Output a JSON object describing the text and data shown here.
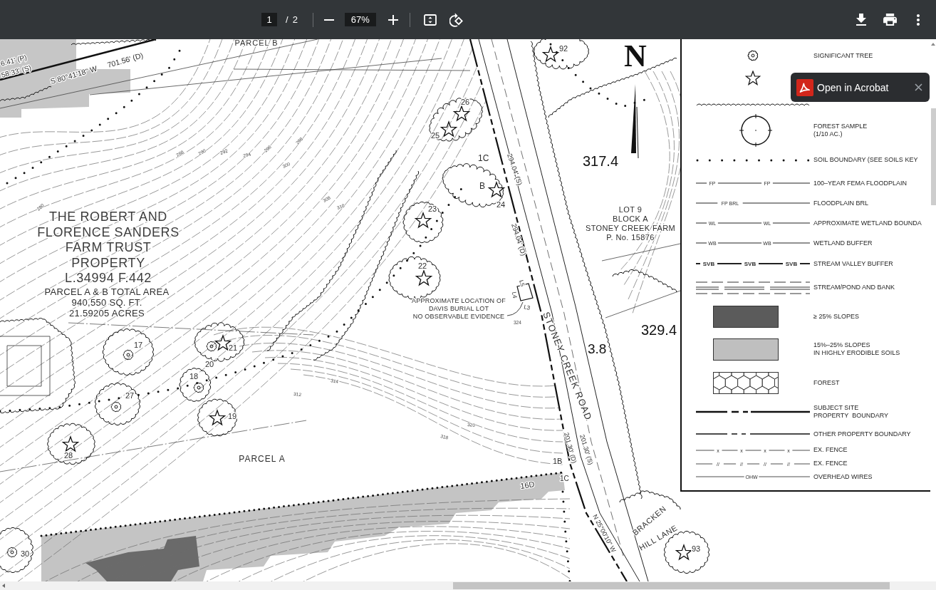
{
  "toolbar": {
    "page_number": "1",
    "page_separator": "/",
    "page_count": "2",
    "zoom_value": "67%"
  },
  "popup": {
    "label": "Open in Acrobat"
  },
  "map": {
    "parcel_labels": [
      "PARCEL B",
      "PARCEL A"
    ],
    "property_title": [
      "THE ROBERT AND",
      "FLORENCE SANDERS",
      "FARM TRUST",
      "PROPERTY",
      "L.34994 F.442"
    ],
    "property_area": [
      "PARCEL A & B TOTAL AREA",
      "940,550 SQ. FT.",
      "21.59205 ACRES"
    ],
    "bearings": [
      "6.41' (P)",
      "58.33' (S)",
      "S 80°41'18\" W",
      "701.56' (D)",
      "294.04' (S)",
      "294.04' (D)",
      "201.30' (S)",
      "201.30' (D)",
      "N 25°00'10\" W"
    ],
    "trees": [
      {
        "number": "26",
        "kind": "specimen"
      },
      {
        "number": "25",
        "kind": "specimen"
      },
      {
        "number": "24",
        "kind": "specimen"
      },
      {
        "number": "23",
        "kind": "specimen"
      },
      {
        "number": "22",
        "kind": "specimen"
      },
      {
        "number": "92",
        "kind": "specimen"
      },
      {
        "number": "17",
        "kind": "significant"
      },
      {
        "number": "21",
        "kind": "specimen"
      },
      {
        "number": "20",
        "kind": "significant"
      },
      {
        "number": "18",
        "kind": "significant"
      },
      {
        "number": "27",
        "kind": "significant"
      },
      {
        "number": "19",
        "kind": "specimen"
      },
      {
        "number": "28",
        "kind": "specimen"
      },
      {
        "number": "30",
        "kind": "significant"
      },
      {
        "number": "93",
        "kind": "specimen"
      }
    ],
    "point_labels": [
      "1C",
      "B",
      "1B",
      "1C",
      "16D"
    ],
    "line_labels": [
      "L5",
      "L4",
      "L3"
    ],
    "burial_note": [
      "APPROXIMATE LOCATION OF",
      "DAVIS BURIAL LOT",
      "NO OBSERVABLE EVIDENCE"
    ],
    "lot_label": [
      "LOT 9",
      "BLOCK A",
      "STONEY CREEK FARM",
      "P. No. 15876"
    ],
    "road_label": "STONEY CREEK ROAD",
    "lane_label": [
      "BRACKEN",
      "HILL LANE"
    ],
    "spot_elevations": [
      "317.4",
      "329.4",
      "3.8"
    ],
    "north_label": "N",
    "contour_labels": [
      "288",
      "290",
      "292",
      "294",
      "296",
      "298",
      "300",
      "308",
      "310",
      "280",
      "314",
      "312",
      "320",
      "318",
      "324"
    ]
  },
  "legend": {
    "rows": [
      {
        "kind": "significant-tree",
        "label": "SIGNIFICANT TREE"
      },
      {
        "kind": "specimen-tree"
      },
      {
        "kind": "canopy"
      },
      {
        "kind": "sample-plot",
        "label": "FOREST SAMPLE\n(1/10 AC.)"
      },
      {
        "kind": "dots",
        "label": "SOIL BOUNDARY (SEE SOILS KEY"
      },
      {
        "kind": "marked-line",
        "marks": [
          "FP",
          "FP"
        ],
        "label": "100–YEAR FEMA FLOODPLAIN"
      },
      {
        "kind": "marked-line",
        "marks": [
          "FP BRL"
        ],
        "label": "FLOODPLAIN BRL"
      },
      {
        "kind": "marked-line",
        "marks": [
          "WL",
          "WL"
        ],
        "label": "APPROXIMATE WETLAND BOUNDA"
      },
      {
        "kind": "marked-line",
        "marks": [
          "WB",
          "WB"
        ],
        "label": "WETLAND BUFFER"
      },
      {
        "kind": "bold-marked-line",
        "marks": [
          "SVB",
          "SVB",
          "SVB"
        ],
        "label": "STREAM VALLEY BUFFER"
      },
      {
        "kind": "stream",
        "label": "STREAM/POND AND BANK"
      },
      {
        "kind": "steep-swatch",
        "label": "≥ 25% SLOPES"
      },
      {
        "kind": "moderate-swatch",
        "label": "15%–25% SLOPES\nIN HIGHLY ERODIBLE SOILS"
      },
      {
        "kind": "forest-swatch",
        "label": "FOREST"
      },
      {
        "kind": "subject-boundary",
        "label": "SUBJECT SITE\nPROPERTY  BOUNDARY"
      },
      {
        "kind": "other-boundary",
        "label": "OTHER PROPERTY BOUNDARY"
      },
      {
        "kind": "fence",
        "marks": [
          "x",
          "x",
          "x",
          "x"
        ],
        "label": "EX. FENCE"
      },
      {
        "kind": "fence",
        "marks": [
          "//",
          "//",
          "//",
          "//"
        ],
        "label": "EX. FENCE"
      },
      {
        "kind": "wires",
        "marks": [
          "OHW"
        ],
        "label": "OVERHEAD WIRES"
      }
    ]
  }
}
